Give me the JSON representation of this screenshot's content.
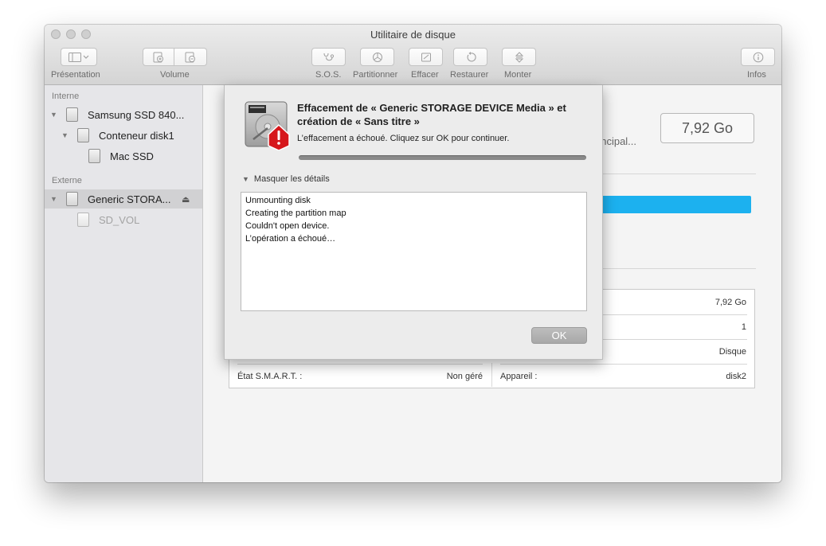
{
  "window": {
    "title": "Utilitaire de disque"
  },
  "toolbar": {
    "presentation_label": "Présentation",
    "volume_label": "Volume",
    "sos_label": "S.O.S.",
    "partition_label": "Partitionner",
    "erase_label": "Effacer",
    "restore_label": "Restaurer",
    "mount_label": "Monter",
    "info_label": "Infos"
  },
  "sidebar": {
    "internal_header": "Interne",
    "external_header": "Externe",
    "items": [
      {
        "label": "Samsung SSD 840..."
      },
      {
        "label": "Conteneur disk1"
      },
      {
        "label": "Mac SSD"
      },
      {
        "label": "Generic STORA..."
      },
      {
        "label": "SD_VOL"
      }
    ],
    "eject_icon": "eject-icon"
  },
  "main": {
    "capacity": "7,92 Go",
    "partial_label": "rincipal...",
    "table": {
      "rows": [
        {
          "right_value": "7,92 Go"
        },
        {
          "right_value": "1"
        },
        {
          "right_value": "Disque"
        },
        {
          "left_label": "État S.M.A.R.T. :",
          "left_value": "Non géré",
          "right_label": "Appareil :",
          "right_value": "disk2"
        }
      ]
    }
  },
  "dialog": {
    "title": "Effacement de « Generic STORAGE DEVICE Media » et création de « Sans titre »",
    "message": "L’effacement a échoué. Cliquez sur OK pour continuer.",
    "progress": 1.0,
    "details_toggle": "Masquer les détails",
    "log": [
      "Unmounting disk",
      "Creating the partition map",
      "Couldn't open device.",
      "L’opération a échoué…"
    ],
    "ok_label": "OK"
  }
}
